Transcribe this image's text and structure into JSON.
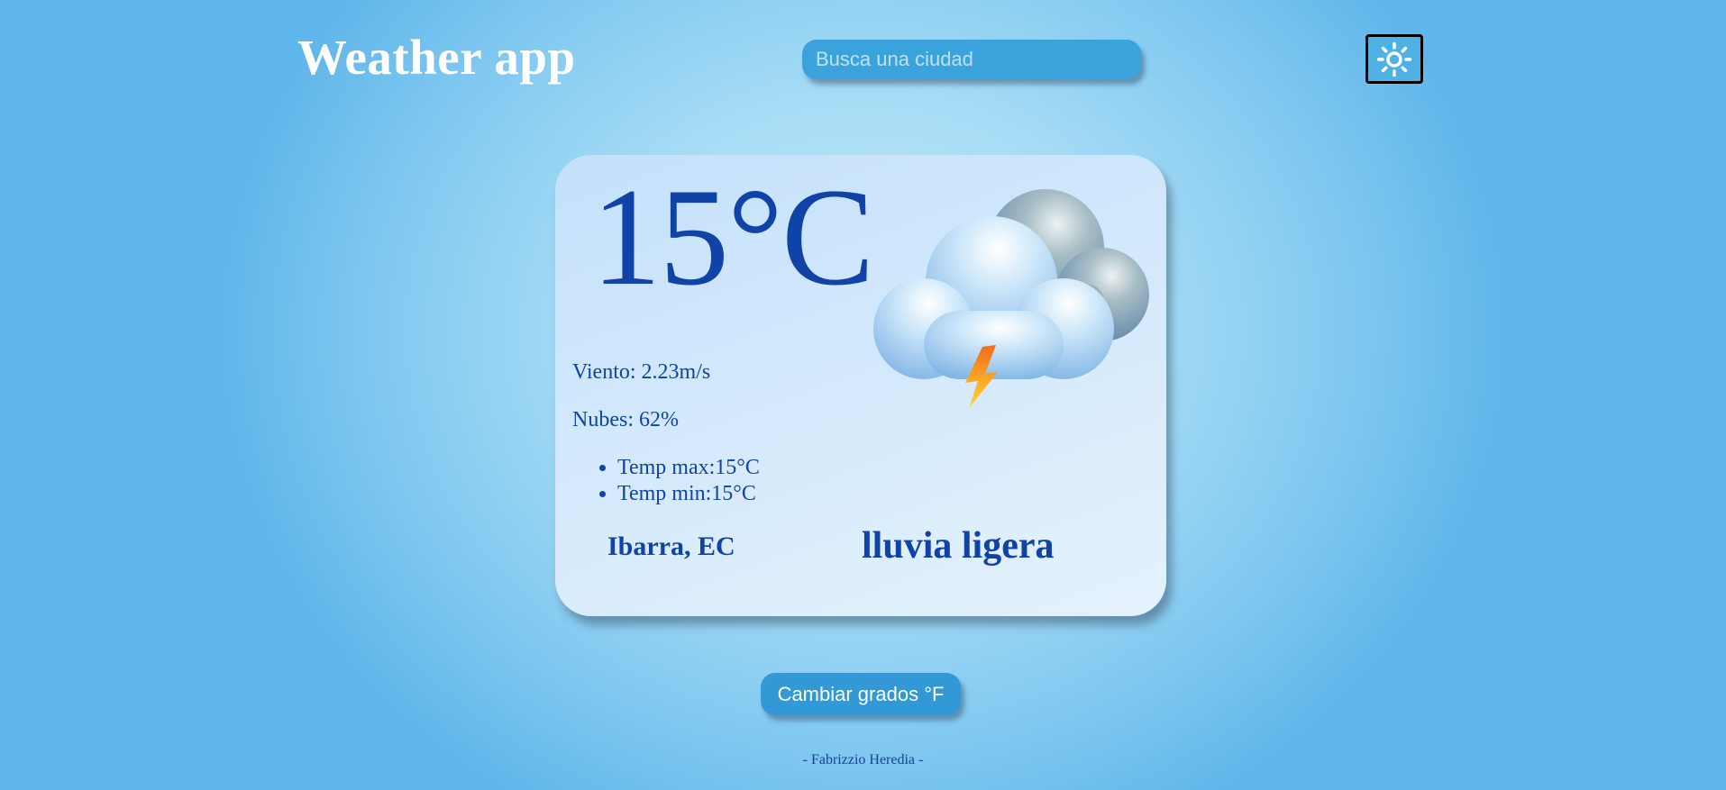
{
  "header": {
    "title": "Weather app",
    "search_placeholder": "Busca una ciudad",
    "theme_toggle_icon": "sun-icon"
  },
  "weather": {
    "temperature": "15°C",
    "wind": "Viento: 2.23m/s",
    "clouds": "Nubes: 62%",
    "temp_max": "Temp max:15°C",
    "temp_min": "Temp min:15°C",
    "location": "Ibarra, EC",
    "description": "lluvia ligera",
    "icon": "storm-cloud-icon"
  },
  "actions": {
    "convert_label": "Cambiar grados °F"
  },
  "footer": {
    "text": "- Fabrizzio Heredia -"
  },
  "colors": {
    "background": "#a9ddf6",
    "accent": "#3ba3dc",
    "text_primary": "#0f43a8",
    "card": "#d6eafc"
  }
}
